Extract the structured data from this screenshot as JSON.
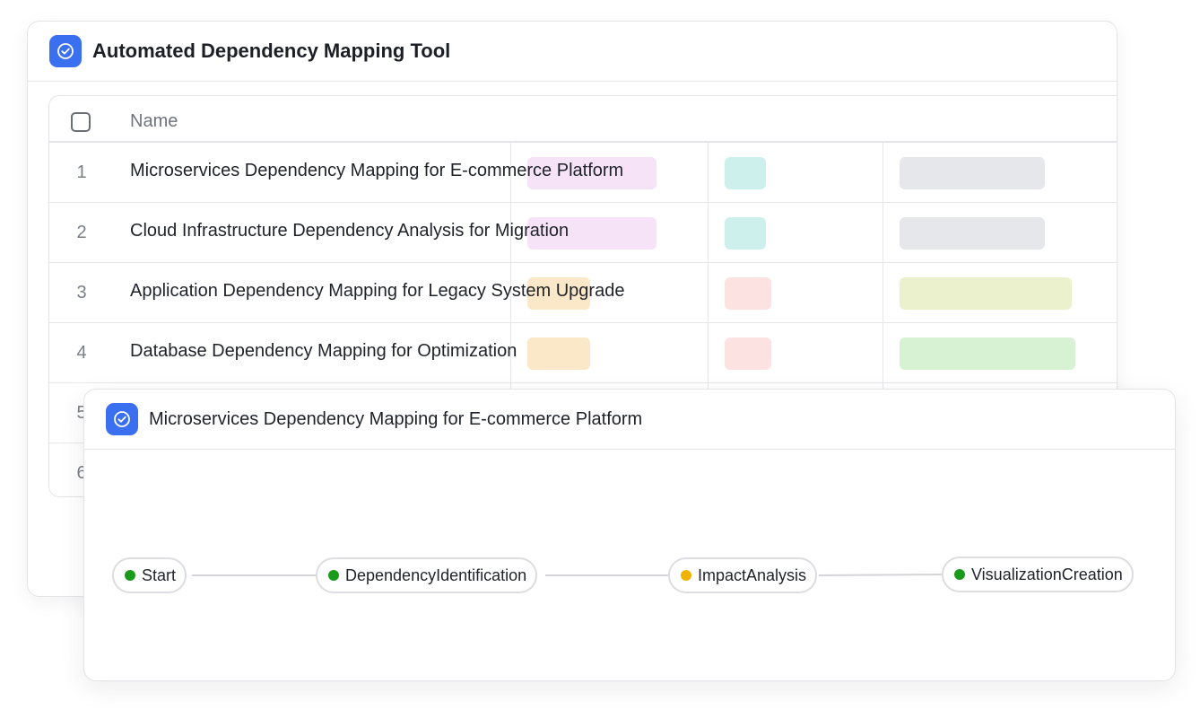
{
  "app": {
    "title": "Automated Dependency Mapping Tool"
  },
  "table": {
    "header": {
      "name": "Name"
    },
    "rows": [
      {
        "num": "1",
        "title": "Microservices Dependency Mapping for E-commerce Platform"
      },
      {
        "num": "2",
        "title": "Cloud Infrastructure Dependency Analysis for Migration"
      },
      {
        "num": "3",
        "title": "Application Dependency Mapping for Legacy System Upgrade"
      },
      {
        "num": "4",
        "title": "Database Dependency Mapping for Optimization"
      },
      {
        "num": "5",
        "title": ""
      },
      {
        "num": "6",
        "title": ""
      }
    ]
  },
  "detail": {
    "title": "Microservices Dependency Mapping for E-commerce Platform",
    "nodes": [
      {
        "label": "Start",
        "status_color": "#1a9a1a"
      },
      {
        "label": "DependencyIdentification",
        "status_color": "#1a9a1a"
      },
      {
        "label": "ImpactAnalysis",
        "status_color": "#f0b400"
      },
      {
        "label": "VisualizationCreation",
        "status_color": "#1a9a1a"
      }
    ]
  },
  "colors": {
    "accent": "#3a6ff0",
    "chip_pink": "#f6e3f8",
    "chip_orange": "#fbe8c9",
    "chip_teal": "#cdf0ec",
    "chip_red": "#fce3e1",
    "chip_gray": "#e6e7ea",
    "chip_lime": "#ebf1cd",
    "chip_green": "#d6f2d2"
  }
}
